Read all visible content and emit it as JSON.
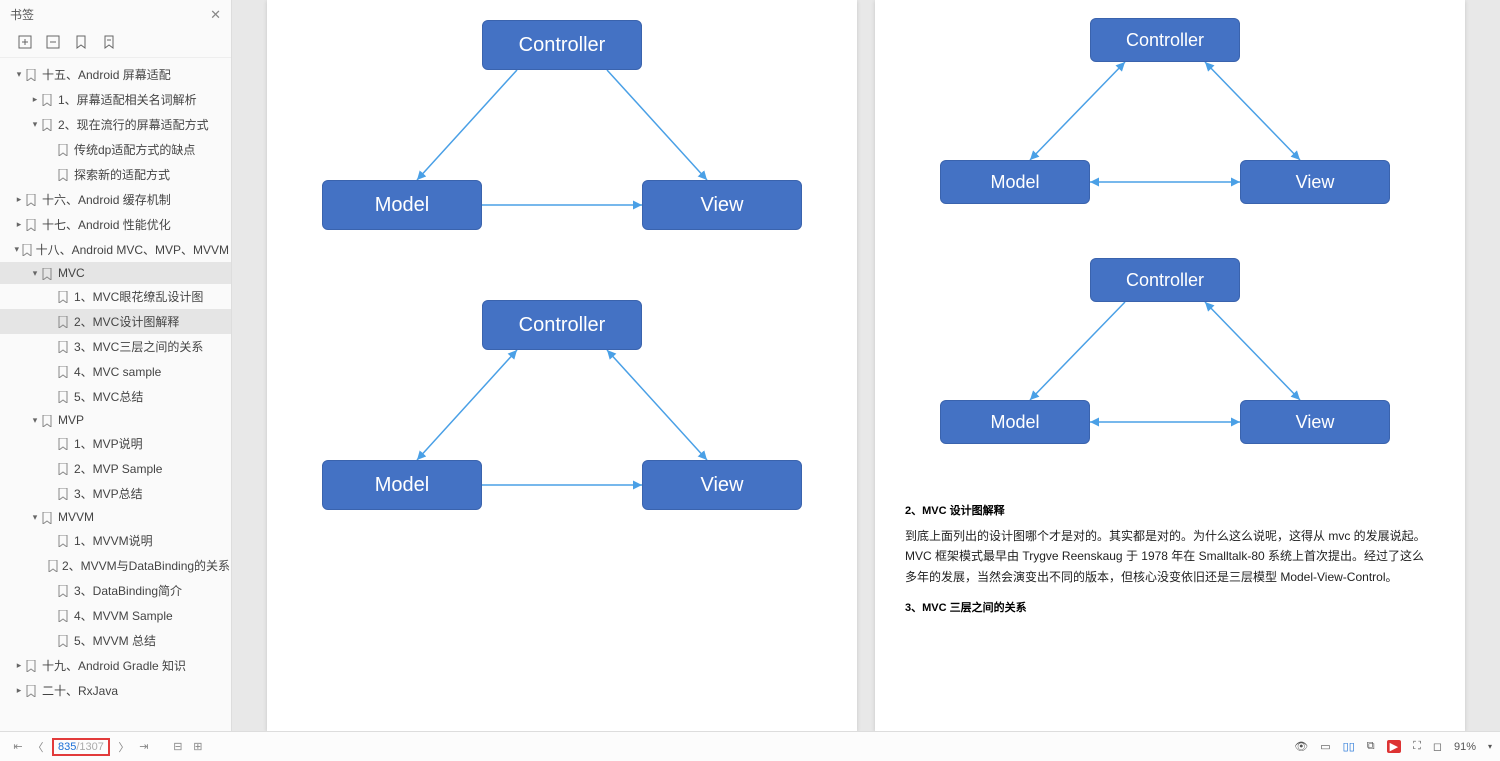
{
  "sidebar": {
    "title": "书签",
    "toolbar_icons": [
      "expand-all-icon",
      "collapse-all-icon",
      "bookmark-icon",
      "bookmark-alt-icon"
    ],
    "items": [
      {
        "level": 0,
        "caret": "▾",
        "label": "十五、Android 屏幕适配",
        "sel": false
      },
      {
        "level": 1,
        "caret": "▸",
        "label": "1、屏幕适配相关名词解析",
        "sel": false
      },
      {
        "level": 1,
        "caret": "▾",
        "label": "2、现在流行的屏幕适配方式",
        "sel": false
      },
      {
        "level": 2,
        "caret": "",
        "label": "传统dp适配方式的缺点",
        "sel": false
      },
      {
        "level": 2,
        "caret": "",
        "label": "探索新的适配方式",
        "sel": false
      },
      {
        "level": 0,
        "caret": "▸",
        "label": "十六、Android 缓存机制",
        "sel": false
      },
      {
        "level": 0,
        "caret": "▸",
        "label": "十七、Android 性能优化",
        "sel": false
      },
      {
        "level": 0,
        "caret": "▾",
        "label": "十八、Android MVC、MVP、MVVM",
        "sel": false
      },
      {
        "level": 1,
        "caret": "▾",
        "label": "MVC",
        "sel": true
      },
      {
        "level": 2,
        "caret": "",
        "label": "1、MVC眼花缭乱设计图",
        "sel": false
      },
      {
        "level": 2,
        "caret": "",
        "label": "2、MVC设计图解释",
        "sel": true
      },
      {
        "level": 2,
        "caret": "",
        "label": "3、MVC三层之间的关系",
        "sel": false
      },
      {
        "level": 2,
        "caret": "",
        "label": "4、MVC sample",
        "sel": false
      },
      {
        "level": 2,
        "caret": "",
        "label": "5、MVC总结",
        "sel": false
      },
      {
        "level": 1,
        "caret": "▾",
        "label": "MVP",
        "sel": false
      },
      {
        "level": 2,
        "caret": "",
        "label": "1、MVP说明",
        "sel": false
      },
      {
        "level": 2,
        "caret": "",
        "label": "2、MVP Sample",
        "sel": false
      },
      {
        "level": 2,
        "caret": "",
        "label": "3、MVP总结",
        "sel": false
      },
      {
        "level": 1,
        "caret": "▾",
        "label": "MVVM",
        "sel": false
      },
      {
        "level": 2,
        "caret": "",
        "label": "1、MVVM说明",
        "sel": false
      },
      {
        "level": 2,
        "caret": "",
        "label": "2、MVVM与DataBinding的关系",
        "sel": false
      },
      {
        "level": 2,
        "caret": "",
        "label": "3、DataBinding简介",
        "sel": false
      },
      {
        "level": 2,
        "caret": "",
        "label": "4、MVVM Sample",
        "sel": false
      },
      {
        "level": 2,
        "caret": "",
        "label": "5、MVVM 总结",
        "sel": false
      },
      {
        "level": 0,
        "caret": "▸",
        "label": "十九、Android Gradle 知识",
        "sel": false
      },
      {
        "level": 0,
        "caret": "▸",
        "label": "二十、RxJava",
        "sel": false
      }
    ]
  },
  "diagram_labels": {
    "controller": "Controller",
    "model": "Model",
    "view": "View"
  },
  "page_right": {
    "section2_title": "2、MVC 设计图解释",
    "para1": "到底上面列出的设计图哪个才是对的。其实都是对的。为什么这么说呢，这得从 mvc 的发展说起。 MVC 框架模式最早由 Trygve Reenskaug 于 1978 年在 Smalltalk-80 系统上首次提出。经过了这么多年的发展，当然会演变出不同的版本，但核心没变依旧还是三层模型 Model-View-Control。",
    "section3_title": "3、MVC 三层之间的关系"
  },
  "bottombar": {
    "current_page": "835",
    "total_pages": "/1307",
    "zoom": "91%"
  }
}
